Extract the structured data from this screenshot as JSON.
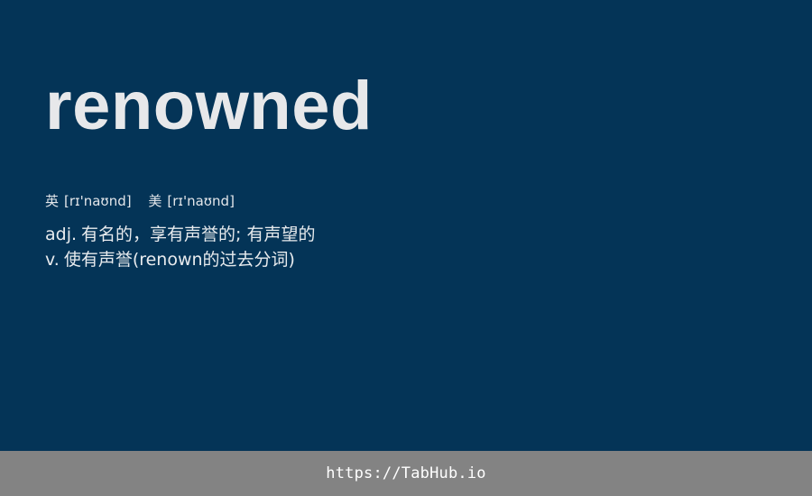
{
  "word": "renowned",
  "phonetics": [
    {
      "label": "英",
      "ipa": "[rɪ'naʊnd]"
    },
    {
      "label": "美",
      "ipa": "[rɪ'naʊnd]"
    }
  ],
  "definitions": [
    {
      "pos": "adj.",
      "meaning": "有名的，享有声誉的; 有声望的"
    },
    {
      "pos": "v.",
      "meaning": "使有声誉(renown的过去分词)"
    }
  ],
  "footer": {
    "link_text": "https://TabHub.io"
  },
  "colors": {
    "background": "#043457",
    "footer_background": "#838383",
    "text": "#e7e8ea"
  }
}
